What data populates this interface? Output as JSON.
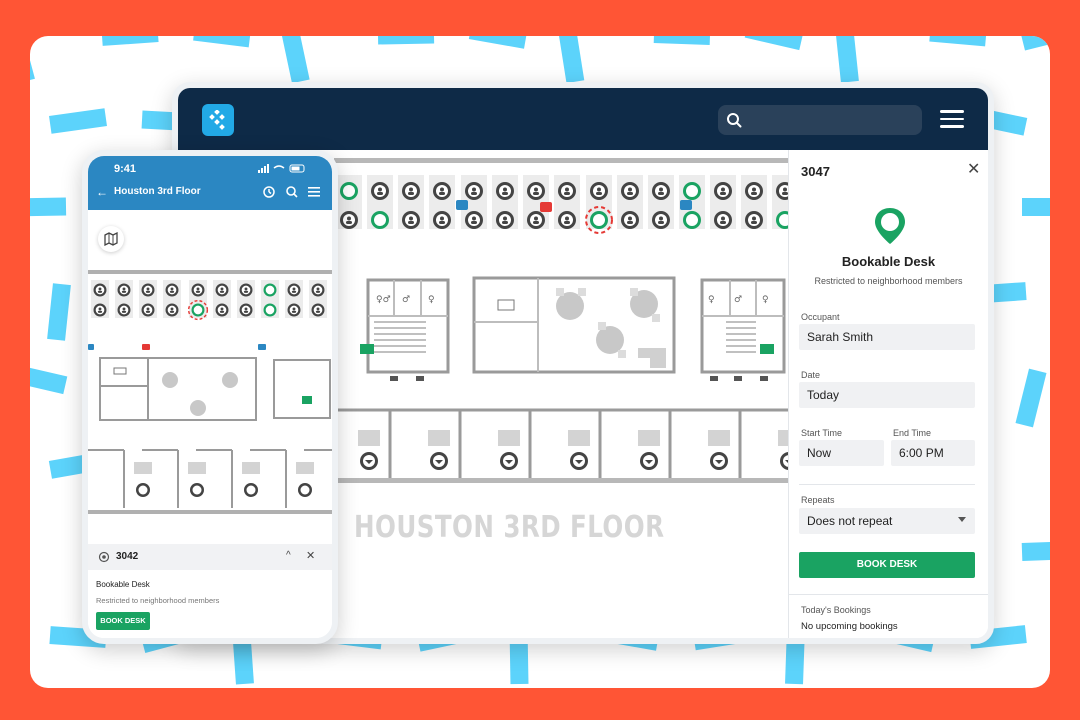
{
  "colors": {
    "background": "#ff5535",
    "nav_dark": "#0e2a47",
    "phone_header": "#2b87c2",
    "accent_green": "#1aa362",
    "pattern_blue": "#5cd3fb",
    "alert_red": "#e53935"
  },
  "desktop": {
    "header": {
      "logo_icon": "logo-icon",
      "search_icon": "search-icon",
      "menu_icon": "hamburger-icon"
    },
    "floor_title": "HOUSTON 3RD FLOOR",
    "panel": {
      "desk_id": "3047",
      "close_icon": "✕",
      "status": "Bookable Desk",
      "restriction": "Restricted to neighborhood members",
      "occupant_label": "Occupant",
      "occupant_value": "Sarah Smith",
      "date_label": "Date",
      "date_value": "Today",
      "start_label": "Start Time",
      "start_value": "Now",
      "end_label": "End Time",
      "end_value": "6:00 PM",
      "repeats_label": "Repeats",
      "repeats_value": "Does not repeat",
      "book_button": "BOOK DESK",
      "bookings_label": "Today's Bookings",
      "bookings_value": "No upcoming bookings"
    }
  },
  "phone": {
    "status_time": "9:41",
    "back_icon": "←",
    "title": "Houston 3rd Floor",
    "sheet": {
      "desk_id": "3042",
      "collapse_icon": "^",
      "close_icon": "✕",
      "status": "Bookable Desk",
      "restriction": "Restricted to neighborhood members",
      "book_button": "BOOK DESK"
    }
  }
}
